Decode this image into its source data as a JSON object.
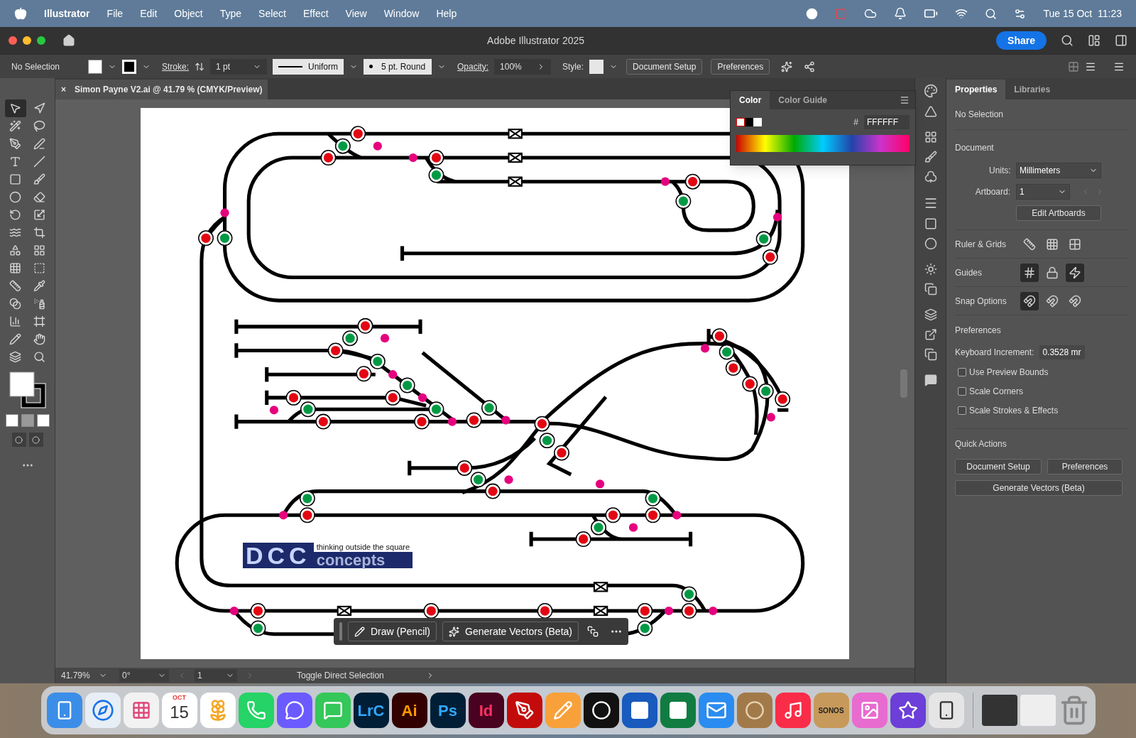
{
  "menu_bar": {
    "app": "Illustrator",
    "items": [
      "File",
      "Edit",
      "Object",
      "Type",
      "Select",
      "Effect",
      "View",
      "Window",
      "Help"
    ],
    "clock": "Tue 15 Oct  11:23"
  },
  "window": {
    "title": "Adobe Illustrator 2025",
    "share": "Share"
  },
  "control_bar": {
    "selection": "No Selection",
    "stroke_label": "Stroke:",
    "stroke_value": "1 pt",
    "profile": "Uniform",
    "brush": "5 pt. Round",
    "opacity_label": "Opacity:",
    "opacity_value": "100%",
    "style_label": "Style:",
    "buttons": [
      "Document Setup",
      "Preferences"
    ]
  },
  "document_tab": {
    "close": "×",
    "title": "Simon Payne V2.ai @ 41.79 % (CMYK/Preview)"
  },
  "tools": [
    {
      "selected": true
    },
    {
      "selected": false
    },
    {
      "selected": false
    },
    {
      "selected": false
    },
    {
      "selected": false
    },
    {
      "selected": false
    },
    {
      "selected": false
    },
    {
      "selected": false
    },
    {
      "selected": false
    },
    {
      "selected": false
    },
    {
      "selected": false
    },
    {
      "selected": false
    },
    {
      "selected": false
    },
    {
      "selected": false
    },
    {
      "selected": false
    },
    {
      "selected": false
    },
    {
      "selected": false
    },
    {
      "selected": false
    },
    {
      "selected": false
    },
    {
      "selected": false
    },
    {
      "selected": false
    },
    {
      "selected": false
    },
    {
      "selected": false
    },
    {
      "selected": false
    },
    {
      "selected": false
    },
    {
      "selected": false
    },
    {
      "selected": false
    },
    {
      "selected": false
    },
    {
      "selected": false
    },
    {
      "selected": false
    },
    {
      "selected": false
    },
    {
      "selected": false
    },
    {
      "selected": false
    },
    {
      "selected": false
    },
    {
      "selected": false
    },
    {
      "selected": false
    }
  ],
  "artboard": {
    "logo_letters": "DCC",
    "logo_tagline": "thinking outside the square",
    "logo_word": "concepts"
  },
  "context_toolbar": {
    "buttons": [
      "Draw (Pencil)",
      "Generate Vectors (Beta)"
    ]
  },
  "color_panel": {
    "tabs": [
      {
        "label": "Color",
        "selected": true
      },
      {
        "label": "Color Guide",
        "selected": false
      }
    ],
    "hash": "#",
    "hex": "FFFFFF"
  },
  "properties": {
    "tabs": [
      {
        "label": "Properties",
        "selected": true
      },
      {
        "label": "Libraries",
        "selected": false
      }
    ],
    "selection": "No Selection",
    "document_heading": "Document",
    "units_label": "Units:",
    "units": "Millimeters",
    "artboard_label": "Artboard:",
    "artboard": "1",
    "edit_artboards": "Edit Artboards",
    "ruler_label": "Ruler & Grids",
    "guides_label": "Guides",
    "guides": [
      {
        "selected": true
      },
      {
        "selected": false
      },
      {
        "selected": true
      }
    ],
    "snap_label": "Snap Options",
    "snap": [
      {
        "selected": true
      },
      {
        "selected": false
      },
      {
        "selected": false
      }
    ],
    "preferences_heading": "Preferences",
    "increment_label": "Keyboard Increment:",
    "increment": "0.3528 mr",
    "checkboxes": [
      {
        "label": "Use Preview Bounds",
        "checked": false
      },
      {
        "label": "Scale Corners",
        "checked": false
      },
      {
        "label": "Scale Strokes & Effects",
        "checked": false
      }
    ],
    "quick_actions_heading": "Quick Actions",
    "quick_actions": [
      "Document Setup",
      "Preferences",
      "Generate Vectors (Beta)"
    ]
  },
  "status_bar": {
    "zoom": "41.79%",
    "rotation": "0°",
    "artboard": "1",
    "tool": "Toggle Direct Selection"
  },
  "dock": {
    "calendar_month": "OCT",
    "calendar_day": "15",
    "app_labels": [
      "LrC",
      "Ai",
      "Ps",
      "Id"
    ],
    "speaker_label": "SONOS"
  }
}
